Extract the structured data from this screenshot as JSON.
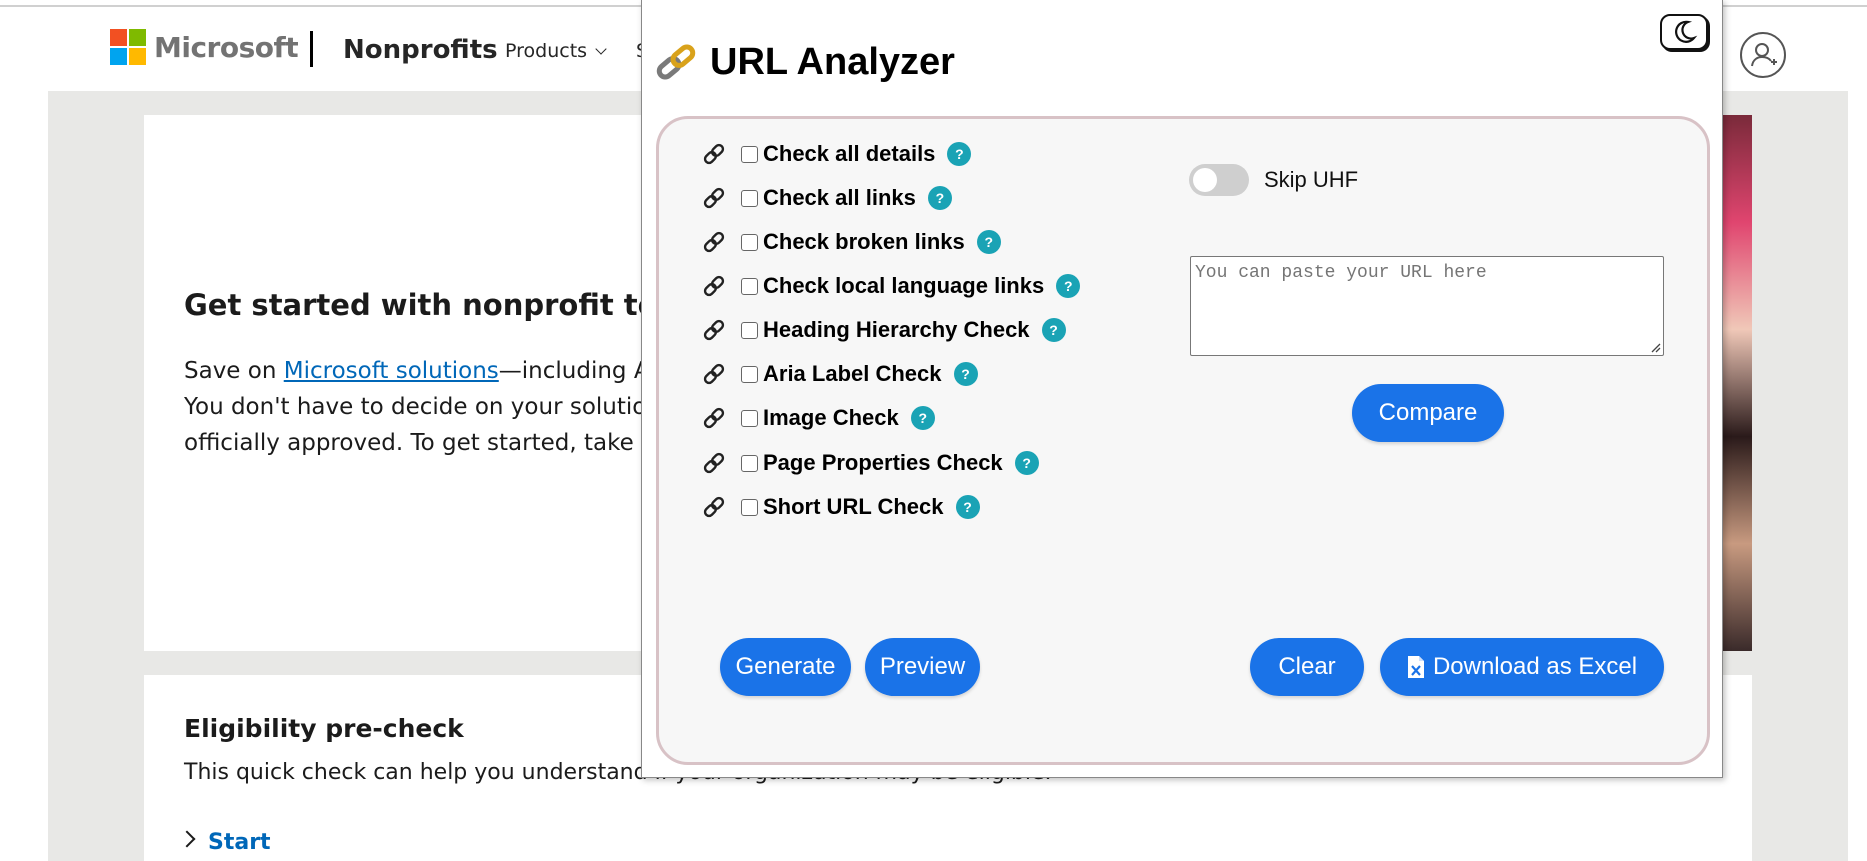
{
  "background_page": {
    "brand": "Microsoft",
    "site_name": "Nonprofits",
    "nav_products": "Products",
    "nav_more": "S",
    "hero_title": "Get started with nonprofit tech to",
    "hero_text_prefix": "Save on ",
    "hero_link": "Microsoft solutions",
    "hero_text_suffix": "—including Azu",
    "hero_line2": "You don't have to decide on your solutions",
    "hero_line3": "officially approved. To get started, take the",
    "eligibility_title": "Eligibility pre-check",
    "eligibility_text": "This quick check can help you understand if your organization may be eligible.",
    "start_link": "Start",
    "colors": {
      "ms_red": "#f25022",
      "ms_green": "#7fba00",
      "ms_blue": "#00a4ef",
      "ms_yellow": "#ffb900",
      "link": "#0067b8",
      "page_bg": "#e8e8e6"
    }
  },
  "analyzer": {
    "title": "URL Analyzer",
    "title_icon": "link-chain-icon",
    "dark_mode_icon": "moon-icon",
    "checks": [
      {
        "label": "Check all details",
        "help": "?"
      },
      {
        "label": "Check all links",
        "help": "?"
      },
      {
        "label": "Check broken links",
        "help": "?"
      },
      {
        "label": "Check local language links",
        "help": "?"
      },
      {
        "label": "Heading Hierarchy Check",
        "help": "?"
      },
      {
        "label": "Aria Label Check",
        "help": "?"
      },
      {
        "label": "Image Check",
        "help": "?"
      },
      {
        "label": "Page Properties Check",
        "help": "?"
      },
      {
        "label": "Short URL Check",
        "help": "?"
      }
    ],
    "skip_uhf_label": "Skip UHF",
    "url_placeholder": "You can paste your URL here",
    "compare_label": "Compare",
    "generate_label": "Generate",
    "preview_label": "Preview",
    "clear_label": "Clear",
    "download_label": "Download as Excel",
    "colors": {
      "button": "#1a73e8",
      "help_badge": "#1aa3b5",
      "panel_bg": "#f7f7f7",
      "panel_border": "#d8c2c6"
    }
  }
}
